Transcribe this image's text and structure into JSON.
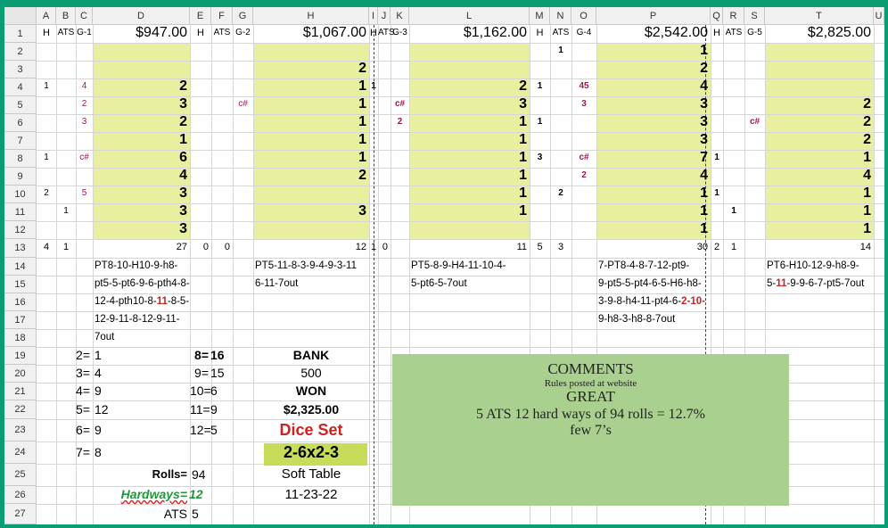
{
  "columns": [
    "A",
    "B",
    "C",
    "D",
    "E",
    "F",
    "G",
    "H",
    "I",
    "J",
    "K",
    "L",
    "M",
    "N",
    "O",
    "P",
    "Q",
    "R",
    "S",
    "T",
    "U"
  ],
  "rows": [
    "1",
    "2",
    "3",
    "4",
    "5",
    "6",
    "7",
    "8",
    "9",
    "10",
    "11",
    "12",
    "13",
    "14",
    "15",
    "16",
    "17",
    "18",
    "19",
    "20",
    "21",
    "22",
    "23",
    "24",
    "25",
    "26",
    "27"
  ],
  "row1": {
    "group1": {
      "h": "H",
      "ats": "ATS",
      "g": "G-1",
      "amount": "$947.00"
    },
    "group2": {
      "h": "H",
      "ats": "ATS",
      "g": "G-2",
      "amount": "$1,067.00"
    },
    "group3": {
      "h": "H",
      "ats": "ATS",
      "g": "G-3",
      "amount": "$1,162.00"
    },
    "group4": {
      "h": "H",
      "ats": "ATS",
      "g": "G-4",
      "amount": "$2,542.00"
    },
    "group5": {
      "h": "H",
      "ats": "ATS",
      "g": "G-5",
      "amount": "$2,825.00"
    }
  },
  "game1": {
    "D": [
      "",
      "",
      "2",
      "3",
      "2",
      "1",
      "6",
      "4",
      "3",
      "3",
      "3"
    ],
    "A": [
      "",
      "",
      "1",
      "",
      "",
      "",
      "1",
      "",
      "2",
      "",
      ""
    ],
    "B": [
      "",
      "",
      "",
      "",
      "",
      "",
      "",
      "",
      "",
      "1",
      ""
    ],
    "C": [
      "",
      "",
      "4",
      "2",
      "3",
      "",
      "c#",
      "",
      "5",
      "",
      ""
    ],
    "totals": {
      "A": "4",
      "B": "1",
      "D": "27"
    },
    "sequence": [
      "PT8-10-H10-9-h8-",
      "pt5-5-pt6-9-6-pth4-8-",
      "12-4-pth10-8-",
      "11",
      "-8-5-",
      "12-9-11-8-12-9-11-",
      "7out"
    ]
  },
  "game2": {
    "H": [
      "",
      "2",
      "1",
      "1",
      "1",
      "1",
      "1",
      "2",
      "",
      "3",
      ""
    ],
    "G": [
      "",
      "",
      "",
      "c#",
      "",
      "",
      "",
      "",
      "",
      "",
      ""
    ],
    "totals": {
      "E": "0",
      "F": "0",
      "H": "12"
    },
    "sequence": [
      "PT5-11-8-3-9-4-9-3-11",
      "6-11-7out"
    ]
  },
  "game3": {
    "I": [
      "",
      "",
      "1",
      "",
      "",
      "",
      "",
      "",
      "",
      "",
      ""
    ],
    "K": [
      "",
      "",
      "",
      "c#",
      "2",
      "",
      "",
      "",
      "",
      "",
      ""
    ],
    "L": [
      "",
      "",
      "2",
      "3",
      "1",
      "1",
      "1",
      "1",
      "1",
      "1",
      ""
    ],
    "N": [
      "",
      "",
      "",
      "",
      "",
      "",
      "",
      "",
      "",
      "",
      ""
    ],
    "totals": {
      "I": "1",
      "J": "0",
      "L": "11"
    },
    "sequence": [
      "PT5-8-9-H4-11-10-4-",
      "5-pt6-5-7out"
    ]
  },
  "game4": {
    "M": [
      "",
      "",
      "1",
      "",
      "1",
      "",
      "3",
      "",
      "",
      "",
      ""
    ],
    "N": [
      "1",
      "",
      "",
      "",
      "",
      "",
      "",
      "",
      "2",
      "",
      ""
    ],
    "O": [
      "",
      "",
      "45",
      "3",
      "",
      "",
      "c#",
      "2",
      "",
      "",
      ""
    ],
    "P": [
      "1",
      "2",
      "4",
      "3",
      "3",
      "3",
      "7",
      "4",
      "1",
      "1",
      "1"
    ],
    "totals": {
      "M": "5",
      "N": "3",
      "P": "30"
    },
    "sequence": [
      "7-PT8-4-8-7-12-pt9-",
      "9-pt5-5-pt4-6-5-H6-h8-",
      "3-9-8-h4-11-pt4-6-",
      "2-10",
      "-",
      "9-h8-3-h8-8-7out"
    ]
  },
  "game5": {
    "Q": [
      "",
      "",
      "",
      "",
      "",
      "",
      "1",
      "",
      "1",
      "",
      ""
    ],
    "R": [
      "",
      "",
      "",
      "",
      "",
      "",
      "",
      "",
      "",
      "1",
      ""
    ],
    "S": [
      "",
      "",
      "",
      "",
      "c#",
      "",
      "",
      "",
      "",
      "",
      ""
    ],
    "T": [
      "",
      "",
      "",
      "2",
      "2",
      "2",
      "1",
      "4",
      "1",
      "1",
      "1"
    ],
    "totals": {
      "Q": "2",
      "R": "1",
      "T": "14"
    },
    "sequence": [
      "PT6-H10-12-9-h8-9-",
      "5-",
      "11",
      "-9-9-6-7-pt5-7out"
    ]
  },
  "stats": {
    "left": [
      {
        "k": "2=",
        "v": "1"
      },
      {
        "k": "3=",
        "v": "4"
      },
      {
        "k": "4=",
        "v": "9"
      },
      {
        "k": "5=",
        "v": "12"
      },
      {
        "k": "6=",
        "v": "9"
      },
      {
        "k": "7=",
        "v": "8"
      }
    ],
    "right": [
      {
        "k": "8=",
        "v": "16"
      },
      {
        "k": "9=",
        "v": "15"
      },
      {
        "k": "10=",
        "v": "6"
      },
      {
        "k": "11=",
        "v": "9"
      },
      {
        "k": "12=",
        "v": "5"
      }
    ],
    "rolls_label": "Rolls=",
    "rolls_value": "94",
    "hardways_label": "Hardways=",
    "hardways_value": "12",
    "ats_label": "ATS",
    "ats_value": "5"
  },
  "bank": {
    "bank_label": "BANK",
    "bank_value": "500",
    "won_label": "WON",
    "won_value": "$2,325.00",
    "dice_set_label": "Dice Set",
    "dice_set_value": "2-6x2-3",
    "table": "Soft Table",
    "date": "11-23-22"
  },
  "comments": {
    "title": "COMMENTS",
    "subtitle": "Rules posted at website",
    "line1": "GREAT",
    "line2": "5 ATS 12 hard ways of 94 rolls = 12.7%",
    "line3": "few 7’s"
  },
  "colors": {
    "frame": "#0a9d74",
    "yellow": "#e8f0a0",
    "comments": "#a9d08e",
    "dice_box": "#c8dc5a",
    "red": "#cc2222",
    "maroon": "#9b1b4b",
    "green": "#21963c"
  }
}
